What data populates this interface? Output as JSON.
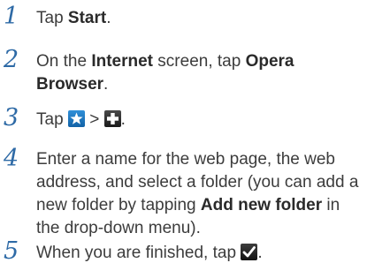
{
  "steps": [
    {
      "number": "1",
      "parts": [
        "Tap ",
        "Start",
        "."
      ]
    },
    {
      "number": "2",
      "parts": [
        "On the ",
        "Internet",
        " screen, tap ",
        "Opera Browser",
        "."
      ]
    },
    {
      "number": "3",
      "parts": [
        "Tap ",
        " > ",
        "."
      ],
      "icons": [
        "star-icon",
        "plus-icon"
      ]
    },
    {
      "number": "4",
      "parts": [
        "Enter a name for the web page, the web address, and select a folder (you can add a new folder by tapping ",
        "Add new folder",
        " in the drop-down menu)."
      ]
    },
    {
      "number": "5",
      "parts": [
        "When you are finished, tap ",
        "."
      ],
      "icons": [
        "checkmark-icon"
      ]
    }
  ],
  "colors": {
    "step_number": "#2e6aa6",
    "body_text": "#3c3c3c",
    "star_icon_bg": "#1f78c4",
    "plus_icon_bg": "#2a2a2a",
    "check_icon_bg": "#222222"
  }
}
